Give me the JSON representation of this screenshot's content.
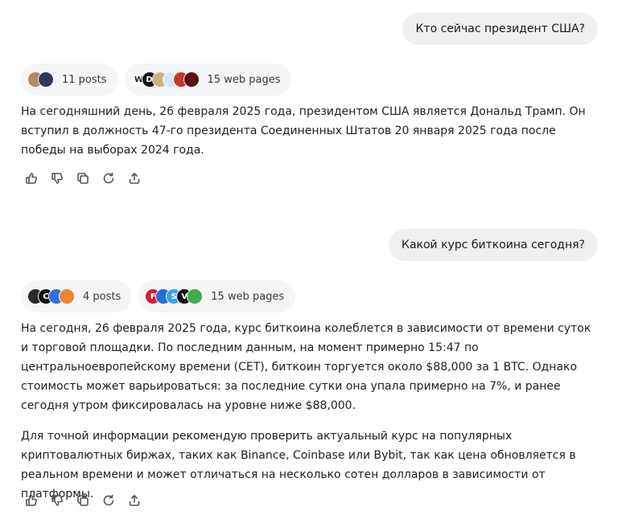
{
  "conversation": [
    {
      "question": "Кто сейчас президент США?",
      "posts_label": "11 posts",
      "web_label": "15 web pages",
      "post_icons": [
        {
          "name": "avatar-portrait-icon",
          "color": "#b08a66",
          "glyph": ""
        },
        {
          "name": "white-house-icon",
          "color": "#2d3b55",
          "glyph": ""
        }
      ],
      "web_icons": [
        {
          "name": "wikipedia-icon",
          "color": "#ffffff",
          "glyph": "W"
        },
        {
          "name": "d-logo-icon",
          "color": "#111111",
          "glyph": "D"
        },
        {
          "name": "seal-icon",
          "color": "#c9b37a",
          "glyph": ""
        },
        {
          "name": "blue-bird-icon",
          "color": "#d6e6f5",
          "glyph": ""
        },
        {
          "name": "flag-icon",
          "color": "#c0392b",
          "glyph": ""
        },
        {
          "name": "dark-red-circle-icon",
          "color": "#5b0f18",
          "glyph": ""
        }
      ],
      "paragraphs": [
        "На сегодняшний день, 26 февраля 2025 года, президентом США является Дональд Трамп. Он вступил в должность 47-го президента Соединенных Штатов 20 января 2025 года после победы на выборах 2024 года."
      ]
    },
    {
      "question": "Какой курс биткоина сегодня?",
      "posts_label": "4 posts",
      "web_label": "15 web pages",
      "post_icons": [
        {
          "name": "eye-logo-icon",
          "color": "#2b2b2b",
          "glyph": ""
        },
        {
          "name": "c-logo-icon",
          "color": "#111111",
          "glyph": "C"
        },
        {
          "name": "blue-wave-icon",
          "color": "#2f6fe0",
          "glyph": ""
        },
        {
          "name": "orange-avatar-icon",
          "color": "#e8872f",
          "glyph": ""
        }
      ],
      "web_icons": [
        {
          "name": "fx-logo-icon",
          "color": "#d0222f",
          "glyph": "F"
        },
        {
          "name": "blue-circle-icon",
          "color": "#1d6fd6",
          "glyph": ""
        },
        {
          "name": "s-logo-icon",
          "color": "#3aa0e8",
          "glyph": "S"
        },
        {
          "name": "black-v-icon",
          "color": "#111111",
          "glyph": "V"
        },
        {
          "name": "green-check-icon",
          "color": "#3fae49",
          "glyph": ""
        }
      ],
      "paragraphs": [
        "На сегодня, 26 февраля 2025 года, курс биткоина колеблется в зависимости от времени суток и торговой площадки. По последним данным, на момент примерно 15:47 по центральноевропейскому времени (CET), биткоин торгуется около $88,000 за 1 BTC. Однако стоимость может варьироваться: за последние сутки она упала примерно на 7%, и ранее сегодня утром фиксировалась на уровне ниже $88,000.",
        "Для точной информации рекомендую проверить актуальный курс на популярных криптовалютных биржах, таких как Binance, Coinbase или Bybit, так как цена обновляется в реальном времени и может отличаться на несколько сотен долларов в зависимости от платформы."
      ]
    }
  ],
  "actions": [
    {
      "name": "like-icon"
    },
    {
      "name": "dislike-icon"
    },
    {
      "name": "copy-icon"
    },
    {
      "name": "regenerate-icon"
    },
    {
      "name": "share-icon"
    }
  ]
}
